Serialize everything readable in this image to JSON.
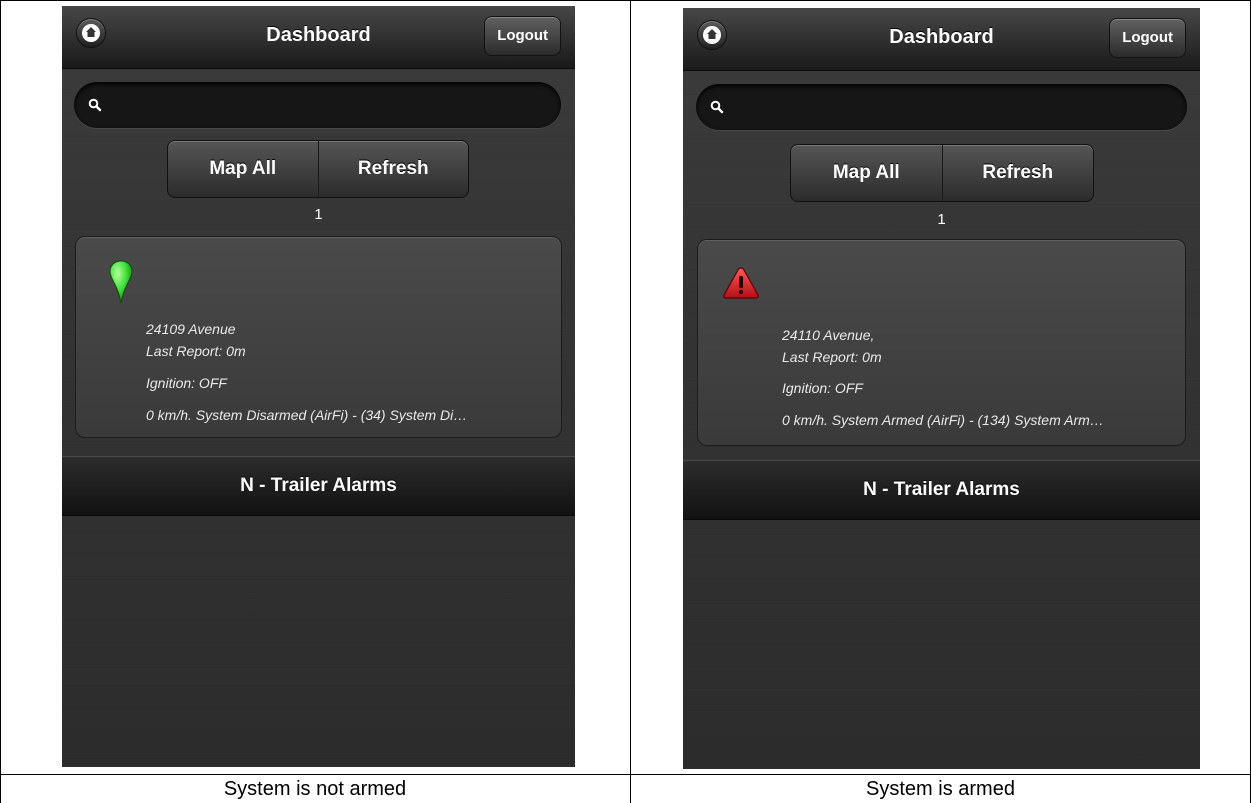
{
  "left": {
    "header": {
      "title": "Dashboard",
      "logout_label": "Logout"
    },
    "search": {
      "value": "",
      "placeholder": ""
    },
    "buttons": {
      "map_all": "Map All",
      "refresh": "Refresh"
    },
    "count": "1",
    "vehicle": {
      "status_icon": "green-map-pin-icon",
      "address": "24109     Avenue",
      "last_report": "Last Report: 0m",
      "ignition": "Ignition: OFF",
      "status": "0 km/h. System Disarmed (AirFi) - (34) System Di…"
    },
    "group_label": "N - Trailer Alarms",
    "caption": "System is not armed"
  },
  "right": {
    "header": {
      "title": "Dashboard",
      "logout_label": "Logout"
    },
    "search": {
      "value": "",
      "placeholder": ""
    },
    "buttons": {
      "map_all": "Map All",
      "refresh": "Refresh"
    },
    "count": "1",
    "vehicle": {
      "status_icon": "red-warning-triangle-icon",
      "address": "24110     Avenue,",
      "last_report": "Last Report: 0m",
      "ignition": "Ignition: OFF",
      "status": "0 km/h. System Armed (AirFi) - (134) System Arm…"
    },
    "group_label": "N - Trailer Alarms",
    "caption": "System is armed"
  },
  "colors": {
    "armed_alert": "#d0202a",
    "disarmed_pin": "#3fe23a",
    "app_background": "#333333"
  }
}
